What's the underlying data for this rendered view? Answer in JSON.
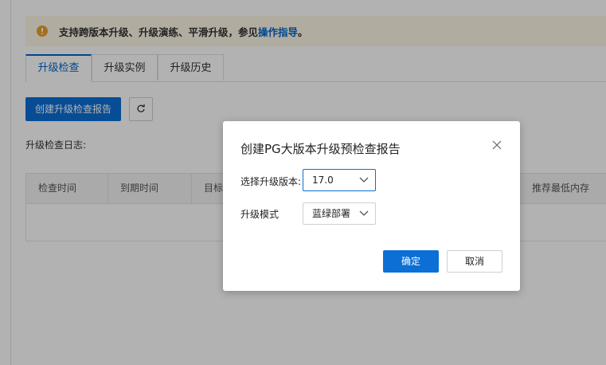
{
  "notice": {
    "text": "支持跨版本升级、升级演练、平滑升级，参见",
    "link": "操作指导",
    "suffix": "。",
    "icon": "warning-icon"
  },
  "tabs": [
    {
      "label": "升级检查",
      "active": true
    },
    {
      "label": "升级实例",
      "active": false
    },
    {
      "label": "升级历史",
      "active": false
    }
  ],
  "toolbar": {
    "create_label": "创建升级检查报告",
    "refresh_icon": "refresh-icon"
  },
  "log_label": "升级检查日志:",
  "table": {
    "columns": [
      "检查时间",
      "到期时间",
      "目标",
      "推荐最低内存"
    ]
  },
  "dialog": {
    "title": "创建PG大版本升级预检查报告",
    "version_label": "选择升级版本:",
    "version_value": "17.0",
    "mode_label": "升级模式",
    "mode_value": "蓝绿部署",
    "ok_label": "确定",
    "cancel_label": "取消"
  },
  "colors": {
    "primary": "#0b6fd6",
    "link": "#0066cc",
    "notice_bg": "#fcf6e6",
    "warning": "#e9a12c"
  }
}
